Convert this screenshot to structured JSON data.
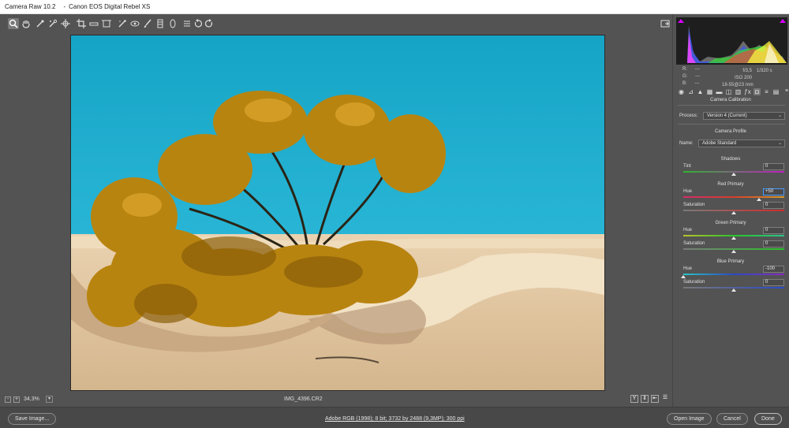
{
  "window": {
    "app_title": "Camera Raw 10.2",
    "camera": "Canon EOS Digital Rebel XS"
  },
  "toolbar": {
    "tools": [
      "zoom-tool",
      "hand-tool",
      "white-balance-tool",
      "color-sampler-tool",
      "targeted-adjustment-tool",
      "crop-tool",
      "straighten-tool",
      "transform-tool",
      "spot-removal-tool",
      "red-eye-removal-tool",
      "adjustment-brush-tool",
      "graduated-filter-tool",
      "radial-filter-tool",
      "preferences-tool",
      "rotate-ccw-tool",
      "rotate-cw-tool"
    ]
  },
  "histogram": {
    "r": "---",
    "g": "---",
    "b": "---",
    "aperture": "f/3,5",
    "shutter": "1/320 s",
    "iso": "ISO 200",
    "lens": "18-55@23 mm"
  },
  "panel": {
    "title": "Camera Calibration",
    "process_label": "Process:",
    "process_value": "Version 4 (Current)",
    "camera_profile_title": "Camera Profile",
    "name_label": "Name:",
    "name_value": "Adobe Standard",
    "shadows_title": "Shadows",
    "tint_label": "Tint",
    "tint_value": "0",
    "red_title": "Red Primary",
    "red_hue_label": "Hue",
    "red_hue_value": "+50",
    "red_sat_label": "Saturation",
    "red_sat_value": "0",
    "green_title": "Green Primary",
    "green_hue_label": "Hue",
    "green_hue_value": "0",
    "green_sat_label": "Saturation",
    "green_sat_value": "0",
    "blue_title": "Blue Primary",
    "blue_hue_label": "Hue",
    "blue_hue_value": "-100",
    "blue_sat_label": "Saturation",
    "blue_sat_value": "0"
  },
  "sliders": {
    "tint": 0.5,
    "red_hue": 0.75,
    "red_sat": 0.5,
    "green_hue": 0.5,
    "green_sat": 0.5,
    "blue_hue": 0.0,
    "blue_sat": 0.5
  },
  "status": {
    "zoom_minus": "-",
    "zoom_plus": "+",
    "zoom": "34,3%",
    "filename": "IMG_4396.CR2"
  },
  "footer": {
    "save_image": "Save Image...",
    "workflow": "Adobe RGB (1998); 8 bit; 3732 by 2488 (9,3MP); 300 ppi",
    "open_image": "Open Image",
    "cancel": "Cancel",
    "done": "Done"
  },
  "colors": {
    "sky": "#1aa6c8",
    "foliage": "#c08a14",
    "sand": "#e3c9a4",
    "focus": "#4a9cff"
  }
}
